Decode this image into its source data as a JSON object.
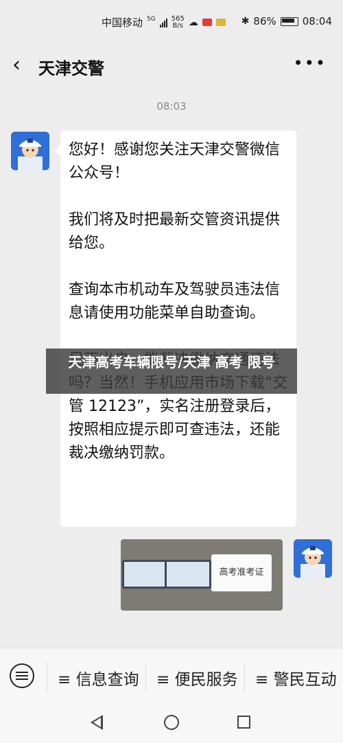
{
  "status_bar": {
    "carrier": "中国移动",
    "network": "5G",
    "speed_value": "565",
    "speed_unit": "B/s",
    "battery": "86%",
    "time": "08:04"
  },
  "nav": {
    "back_icon": "chevron-left-icon",
    "title": "天津交警",
    "more_label": "•••"
  },
  "chat": {
    "timestamp": "08:03",
    "message_paragraphs": [
      "您好！感谢您关注天津交警微信公众号！",
      "我们将及时把最新交管资讯提供给您。",
      "查询本市机动车及驾驶员违法信息请使用功能菜单自助查询。",
      "足不出户，能裁决缴纳交通违法吗？当然！手机应用市场下载“交管 12123”，实名注册登录后，按照相应提示即可查违法，还能裁决缴纳罚款。"
    ],
    "image_stamp_text": "高考准考证"
  },
  "overlay_caption": "天津高考车辆限号/天津 高考 限号",
  "bottom_menu": {
    "items": [
      "≡ 信息查询",
      "≡ 便民服务",
      "≡ 警民互动"
    ]
  },
  "colors": {
    "background": "#ededed",
    "avatar_blue": "#2f6fd8",
    "bubble": "#ffffff"
  }
}
